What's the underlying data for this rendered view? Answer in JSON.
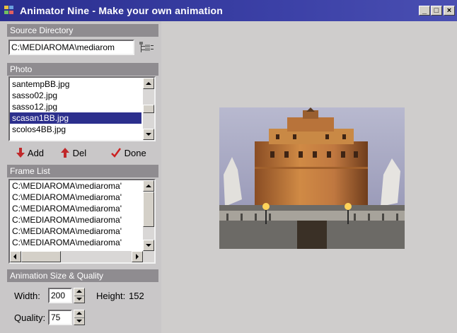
{
  "window": {
    "title": "Animator Nine - Make your own animation",
    "caption_buttons": [
      "_",
      "□",
      "×"
    ]
  },
  "source": {
    "header": "Source Directory",
    "path": "C:\\MEDIAROMA\\mediarom",
    "browse_icon": "folder-tree-icon"
  },
  "photo": {
    "header": "Photo",
    "files": [
      "santempBB.jpg",
      "sasso02.jpg",
      "sasso12.jpg",
      "scasan1BB.jpg",
      "scolos4BB.jpg"
    ],
    "selected_index": 3
  },
  "toolbar": {
    "add_label": "Add",
    "del_label": "Del",
    "done_label": "Done",
    "add_icon": "arrow-down-icon",
    "del_icon": "arrow-up-icon",
    "done_icon": "check-icon"
  },
  "frames": {
    "header": "Frame List",
    "items": [
      "C:\\MEDIAROMA\\mediaroma'",
      "C:\\MEDIAROMA\\mediaroma'",
      "C:\\MEDIAROMA\\mediaroma'",
      "C:\\MEDIAROMA\\mediaroma'",
      "C:\\MEDIAROMA\\mediaroma'",
      "C:\\MEDIAROMA\\mediaroma'"
    ]
  },
  "size_quality": {
    "header": "Animation Size & Quality",
    "width_label": "Width:",
    "width_value": "200",
    "height_label": "Height:",
    "height_value": "152",
    "quality_label": "Quality:",
    "quality_value": "75"
  },
  "colors": {
    "titlebar": "#2b2f8f",
    "selection": "#2c2f8d",
    "add_arrow": "#c0282a",
    "done_check": "#cc2020"
  }
}
